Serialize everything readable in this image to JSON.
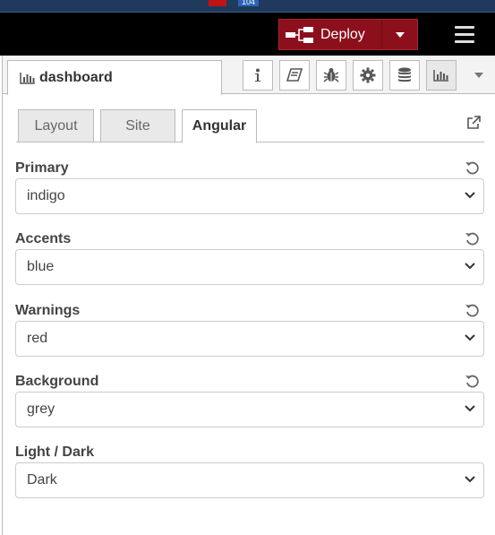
{
  "topstrip": {
    "badge_number": "104"
  },
  "header": {
    "deploy_label": "Deploy"
  },
  "sidebar": {
    "active_tab_label": "dashboard"
  },
  "theme_tabs": [
    {
      "label": "Layout"
    },
    {
      "label": "Site"
    },
    {
      "label": "Angular"
    }
  ],
  "fields": {
    "primary": {
      "label": "Primary",
      "value": "indigo"
    },
    "accents": {
      "label": "Accents",
      "value": "blue"
    },
    "warnings": {
      "label": "Warnings",
      "value": "red"
    },
    "background": {
      "label": "Background",
      "value": "grey"
    },
    "light_dark": {
      "label": "Light / Dark",
      "value": "Dark"
    }
  },
  "colors": {
    "deploy_bg": "#8c101c",
    "header_bg": "#000000",
    "top_strip_bg": "#1f3a5c",
    "tab_inactive_bg": "#e9e9e9"
  },
  "icons": {
    "sidebar_buttons": [
      "info-icon",
      "book-icon",
      "bug-icon",
      "gear-icon",
      "database-icon",
      "dashboard-chart-icon"
    ],
    "deploy": "deploy-nodes-icon",
    "menu": "hamburger-menu-icon",
    "external": "external-link-icon",
    "reset": "reset-icon",
    "select": "chevron-down-icon"
  }
}
